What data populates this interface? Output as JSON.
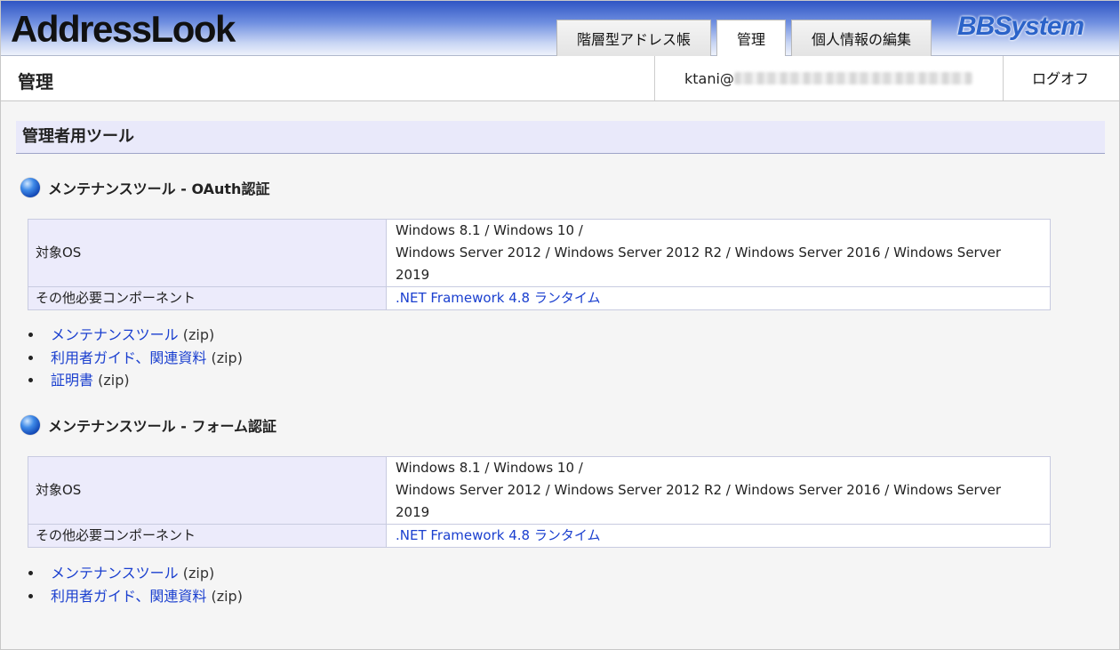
{
  "app": {
    "logo": "AddressLook",
    "brand": "BBSystem"
  },
  "tabs": [
    {
      "label": "階層型アドレス帳",
      "active": false
    },
    {
      "label": "管理",
      "active": true
    },
    {
      "label": "個人情報の編集",
      "active": false
    }
  ],
  "header": {
    "title": "管理",
    "user_prefix": "ktani@",
    "logoff": "ログオフ"
  },
  "section": {
    "title": "管理者用ツール"
  },
  "tools": [
    {
      "heading": "メンテナンスツール - OAuth認証",
      "rows": [
        {
          "key": "対象OS",
          "lines": [
            "Windows 8.1 / Windows 10 /",
            "Windows Server 2012 / Windows Server 2012 R2 / Windows Server 2016 / Windows Server",
            "2019"
          ]
        },
        {
          "key": "その他必要コンポーネント",
          "link": ".NET Framework 4.8 ランタイム"
        }
      ],
      "downloads": [
        {
          "label": "メンテナンスツール",
          "suffix": "(zip)"
        },
        {
          "label": "利用者ガイド、関連資料",
          "suffix": "(zip)"
        },
        {
          "label": "証明書",
          "suffix": "(zip)"
        }
      ]
    },
    {
      "heading": "メンテナンスツール - フォーム認証",
      "rows": [
        {
          "key": "対象OS",
          "lines": [
            "Windows 8.1 / Windows 10 /",
            "Windows Server 2012 / Windows Server 2012 R2 / Windows Server 2016 / Windows Server",
            "2019"
          ]
        },
        {
          "key": "その他必要コンポーネント",
          "link": ".NET Framework 4.8 ランタイム"
        }
      ],
      "downloads": [
        {
          "label": "メンテナンスツール",
          "suffix": "(zip)"
        },
        {
          "label": "利用者ガイド、関連資料",
          "suffix": "(zip)"
        }
      ]
    }
  ]
}
